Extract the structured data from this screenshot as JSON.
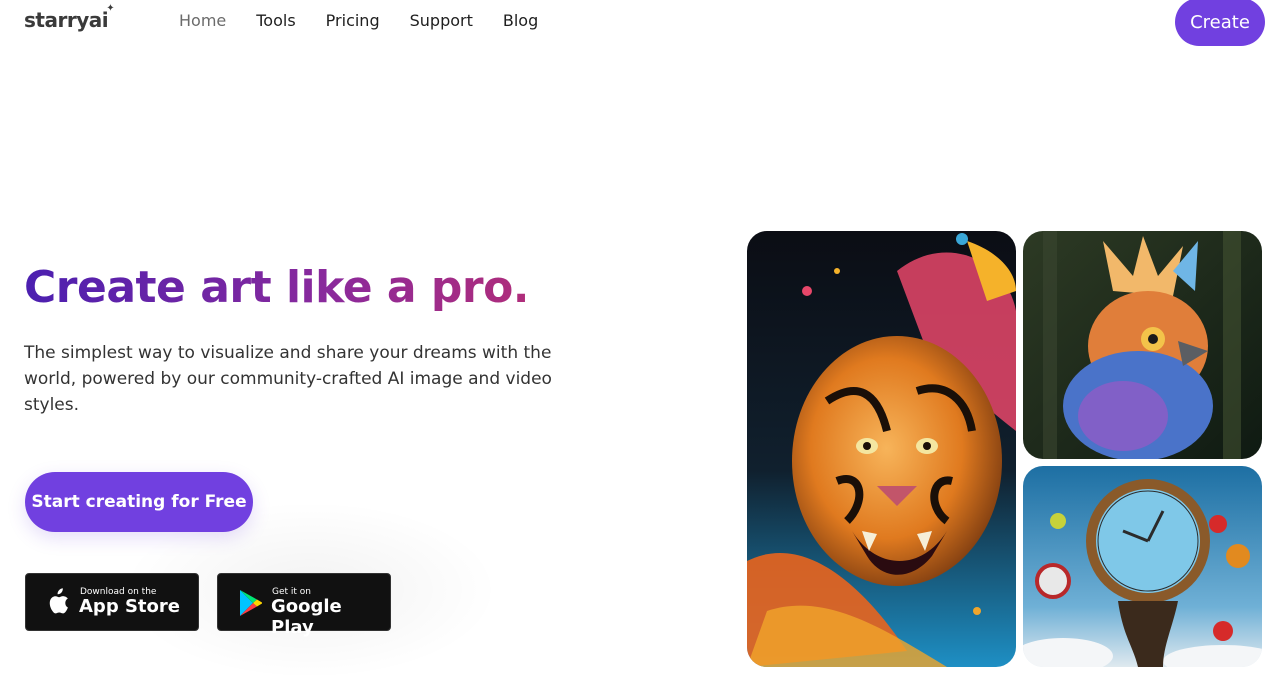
{
  "header": {
    "logo": "starryai",
    "logo_sparkle": "✦",
    "nav": [
      {
        "label": "Home"
      },
      {
        "label": "Tools"
      },
      {
        "label": "Pricing"
      },
      {
        "label": "Support"
      },
      {
        "label": "Blog"
      }
    ],
    "create_label": "Create"
  },
  "hero": {
    "title": "Create art like a pro.",
    "subtitle": "The simplest way to visualize and share your dreams with the world, powered by our community-crafted AI image and video styles.",
    "cta_label": "Start creating for Free"
  },
  "stores": {
    "apple": {
      "small": "Download on the",
      "big": "App Store",
      "icon": "apple-icon"
    },
    "google": {
      "small": "Get it on",
      "big": "Google Play",
      "icon": "google-play-icon"
    }
  },
  "gallery": [
    {
      "name": "tiger-artwork"
    },
    {
      "name": "bird-artwork"
    },
    {
      "name": "clock-artwork"
    }
  ],
  "colors": {
    "accent": "#7140e0",
    "title_gradient_start": "#4b1fb0",
    "title_gradient_end": "#b02d7a"
  }
}
